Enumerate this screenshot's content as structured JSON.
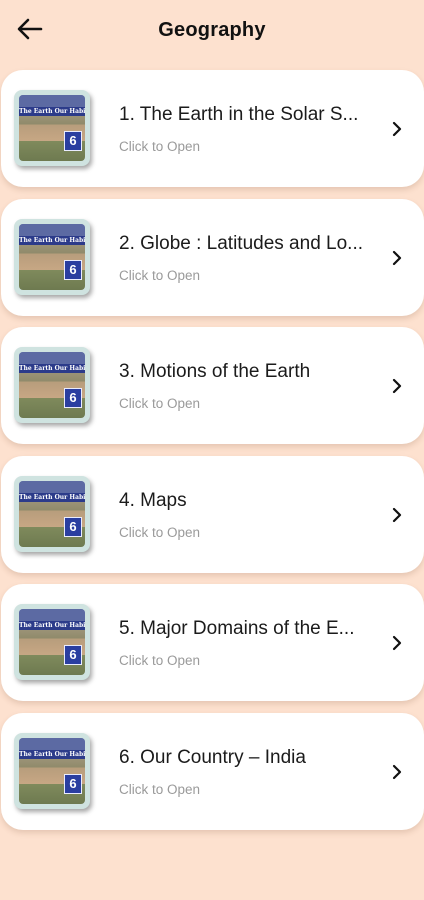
{
  "header": {
    "title": "Geography",
    "back_icon": "arrow-left-icon"
  },
  "thumbnail": {
    "banner_text": "The Earth Our Habitat",
    "badge": "6"
  },
  "chapters": [
    {
      "title": "1. The Earth in the Solar S...",
      "subtitle": "Click to Open"
    },
    {
      "title": "2. Globe : Latitudes and Lo...",
      "subtitle": "Click to Open"
    },
    {
      "title": "3. Motions of the Earth",
      "subtitle": "Click to Open"
    },
    {
      "title": "4. Maps",
      "subtitle": "Click to Open"
    },
    {
      "title": "5. Major Domains of the E...",
      "subtitle": "Click to Open"
    },
    {
      "title": "6. Our Country – India",
      "subtitle": "Click to Open"
    }
  ],
  "colors": {
    "background": "#fde1cf",
    "card": "#ffffff",
    "badge": "#2a3ea0"
  }
}
